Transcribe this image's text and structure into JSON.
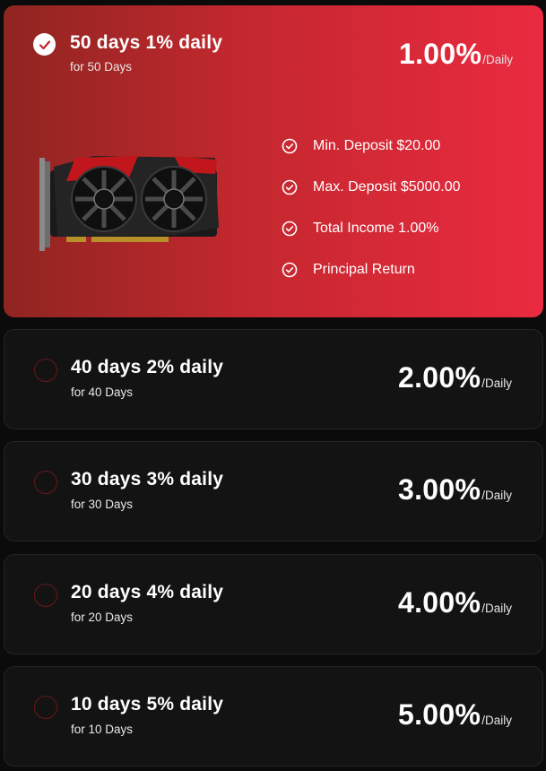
{
  "plans": [
    {
      "title": "50 days 1% daily",
      "subtitle": "for 50 Days",
      "rate": "1.00%",
      "rate_unit": "/Daily",
      "selected": true,
      "features": [
        "Min. Deposit $20.00",
        "Max. Deposit $5000.00",
        "Total Income 1.00%",
        "Principal Return"
      ]
    },
    {
      "title": "40 days 2% daily",
      "subtitle": "for 40 Days",
      "rate": "2.00%",
      "rate_unit": "/Daily",
      "selected": false
    },
    {
      "title": "30 days 3% daily",
      "subtitle": "for 30 Days",
      "rate": "3.00%",
      "rate_unit": "/Daily",
      "selected": false
    },
    {
      "title": "20 days 4% daily",
      "subtitle": "for 20 Days",
      "rate": "4.00%",
      "rate_unit": "/Daily",
      "selected": false
    },
    {
      "title": "10 days 5% daily",
      "subtitle": "for 10 Days",
      "rate": "5.00%",
      "rate_unit": "/Daily",
      "selected": false
    }
  ],
  "icons": {
    "selected_radio": "check-circle-icon",
    "feature": "check-circle-icon",
    "product_image": "graphics-card-icon"
  },
  "colors": {
    "active_gradient_start": "#8f2521",
    "active_gradient_end": "#ea2a40",
    "card_background": "#131313",
    "radio_border": "#6b1717"
  }
}
